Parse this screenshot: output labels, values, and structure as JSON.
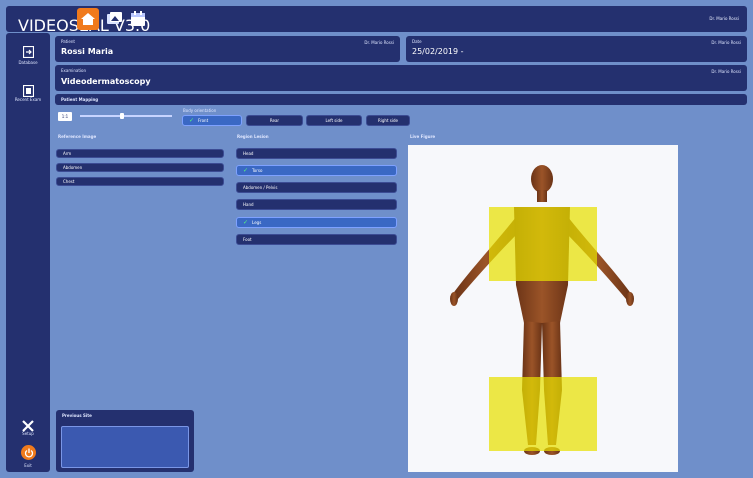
{
  "topbar": {
    "app_label": "VIDEOSEAL V3.0",
    "user": "Dr. Mario Rossi"
  },
  "sidebar": {
    "items": [
      {
        "label": "Database",
        "icon": "database-icon"
      },
      {
        "label": "Recent Exam",
        "icon": "recent-exam-icon"
      }
    ],
    "bottom": [
      {
        "label": "Setup",
        "icon": "tools-icon"
      },
      {
        "label": "Exit",
        "icon": "power-icon"
      }
    ]
  },
  "patient": {
    "label": "Patient",
    "value": "Rossi Maria",
    "doctor": "Dr. Mario Rossi"
  },
  "date": {
    "label": "Date",
    "value": "25/02/2019 -",
    "doctor": "Dr. Mario Rossi"
  },
  "examination": {
    "label": "Examination",
    "value": "Videodermatoscopy",
    "doctor": "Dr. Mario Rossi"
  },
  "section_title": "Patient Mapping",
  "zoom_value": "1:1",
  "view_label": "Body orientation",
  "view_buttons": [
    {
      "label": "Front",
      "selected": true
    },
    {
      "label": "Rear",
      "selected": false
    },
    {
      "label": "Left side",
      "selected": false
    },
    {
      "label": "Right side",
      "selected": false
    }
  ],
  "reference_images": {
    "title": "Reference Image",
    "items": [
      "Arm",
      "Abdomen",
      "Chest"
    ]
  },
  "region_list": {
    "title": "Region Lesion",
    "items": [
      {
        "label": "Head",
        "selected": false
      },
      {
        "label": "Torso",
        "selected": true
      },
      {
        "label": "Abdomen / Pelvis",
        "selected": false
      },
      {
        "label": "Hand",
        "selected": false
      },
      {
        "label": "Legs",
        "selected": false
      },
      {
        "label": "Foot",
        "selected": false
      }
    ]
  },
  "live_figure": {
    "title": "Live Figure",
    "highlight_color": "#e8e000"
  },
  "previous_site": {
    "title": "Previous Site"
  }
}
